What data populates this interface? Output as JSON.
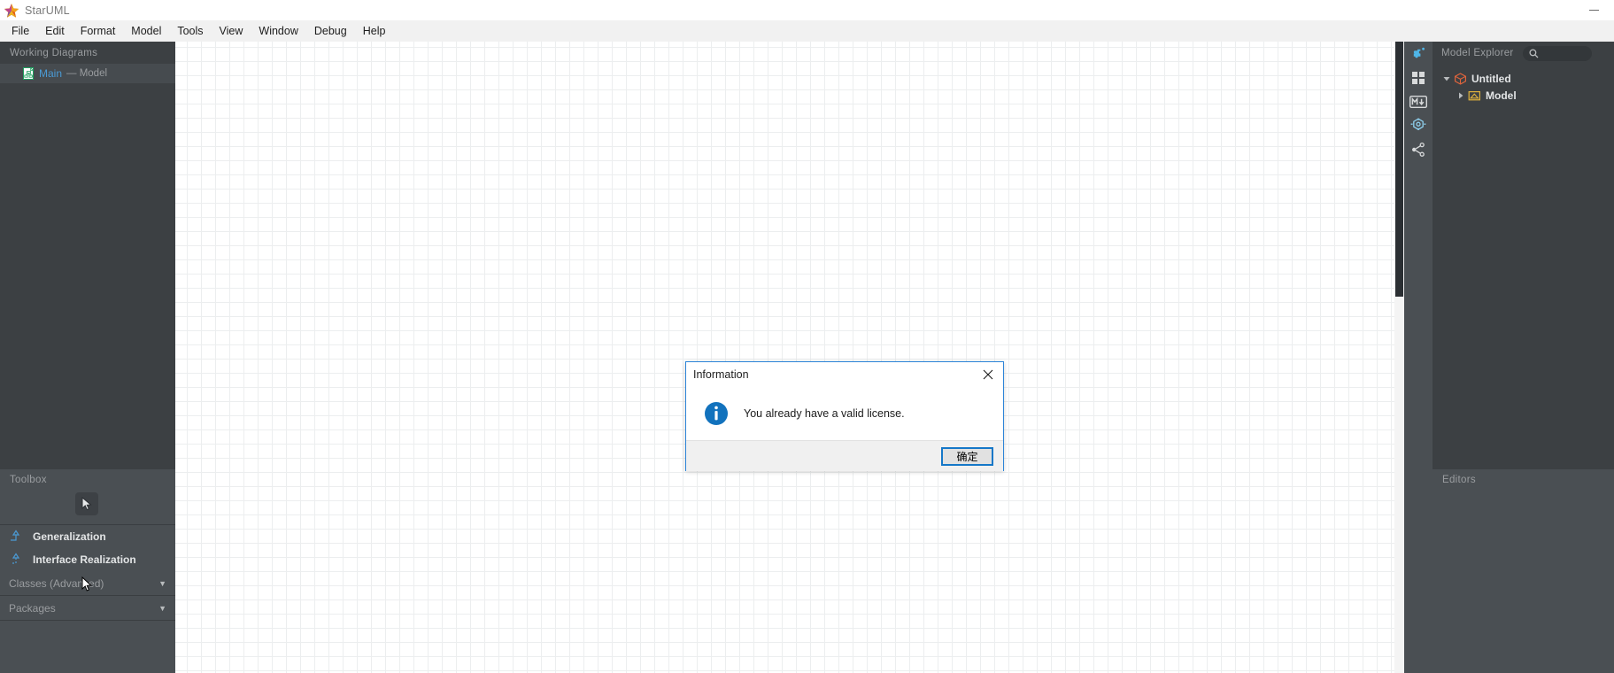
{
  "window": {
    "app_title": "StarUML",
    "logo_icon": "star-icon",
    "minimize_label": "Minimize"
  },
  "menubar": {
    "items": [
      {
        "label": "File"
      },
      {
        "label": "Edit"
      },
      {
        "label": "Format"
      },
      {
        "label": "Model"
      },
      {
        "label": "Tools"
      },
      {
        "label": "View"
      },
      {
        "label": "Window"
      },
      {
        "label": "Debug"
      },
      {
        "label": "Help"
      }
    ]
  },
  "working_diagrams": {
    "title": "Working Diagrams",
    "items": [
      {
        "name": "Main",
        "suffix": "— Model",
        "icon": "class-diagram-icon",
        "selected": true
      }
    ]
  },
  "toolbox": {
    "title": "Toolbox",
    "cursor_tool": "select-pointer-tool",
    "items": [
      {
        "label": "Generalization",
        "icon": "generalization-icon"
      },
      {
        "label": "Interface Realization",
        "icon": "interface-realization-icon"
      }
    ],
    "groups": [
      {
        "label": "Classes (Advanced)",
        "caret": "▼"
      },
      {
        "label": "Packages",
        "caret": "▼"
      }
    ]
  },
  "icon_rail": {
    "buttons": [
      {
        "icon": "extension-puzzle-icon",
        "color": "#4fb6e8"
      },
      {
        "icon": "grid-squares-icon",
        "color": "#d8dadb"
      },
      {
        "icon": "markdown-icon",
        "color": "#d8dadb"
      },
      {
        "icon": "crosshair-target-icon",
        "color": "#8fd0ee"
      },
      {
        "icon": "share-network-icon",
        "color": "#d8dadb"
      }
    ]
  },
  "model_explorer": {
    "title": "Model Explorer",
    "search": {
      "icon": "search-icon",
      "placeholder": "",
      "value": ""
    },
    "tree": [
      {
        "label": "Untitled",
        "icon": "project-cube-icon",
        "expanded": true,
        "arrow": "▾",
        "depth": 0
      },
      {
        "label": "Model",
        "icon": "model-folder-icon",
        "expanded": false,
        "arrow": "▸",
        "depth": 1
      }
    ]
  },
  "editors": {
    "title": "Editors"
  },
  "dialog": {
    "title": "Information",
    "close_icon": "close-icon",
    "message": "You already have a valid license.",
    "icon": "info-icon",
    "ok_label": "确定"
  },
  "colors": {
    "accent_blue": "#1577c8",
    "panel_bg": "#3c4043",
    "toolbox_bg": "#4a4f53",
    "link_blue": "#4a9ad4",
    "canvas_bg": "#ffffff"
  }
}
